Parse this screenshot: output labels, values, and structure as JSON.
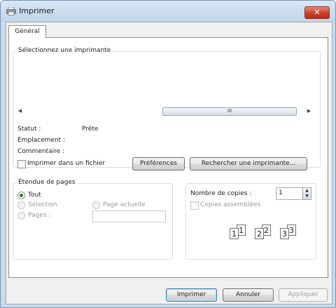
{
  "window": {
    "title": "Imprimer",
    "close_label": "✕"
  },
  "tabs": [
    {
      "label": "Général"
    }
  ],
  "printer_group": {
    "legend": "Sélectionnez une imprimante",
    "scroll_thumb": "III",
    "status_label": "Statut :",
    "status_value": "Prête",
    "location_label": "Emplacement :",
    "comment_label": "Commentaire :",
    "print_to_file_label": "Imprimer dans un fichier",
    "preferences_button": "Préférences",
    "find_printer_button": "Rechercher une imprimante..."
  },
  "page_range": {
    "legend": "Étendue de pages",
    "all_label": "Tout",
    "selection_label": "Sélection",
    "current_page_label": "Page actuelle",
    "pages_label": "Pages :",
    "selected": "all"
  },
  "copies": {
    "label": "Nombre de copies :",
    "value": "1",
    "collate_label": "Copies assemblées",
    "collate_pages": [
      "1",
      "1",
      "2",
      "2",
      "3",
      "3"
    ]
  },
  "buttons": {
    "print": "Imprimer",
    "cancel": "Annuler",
    "apply": "Appliquer"
  }
}
